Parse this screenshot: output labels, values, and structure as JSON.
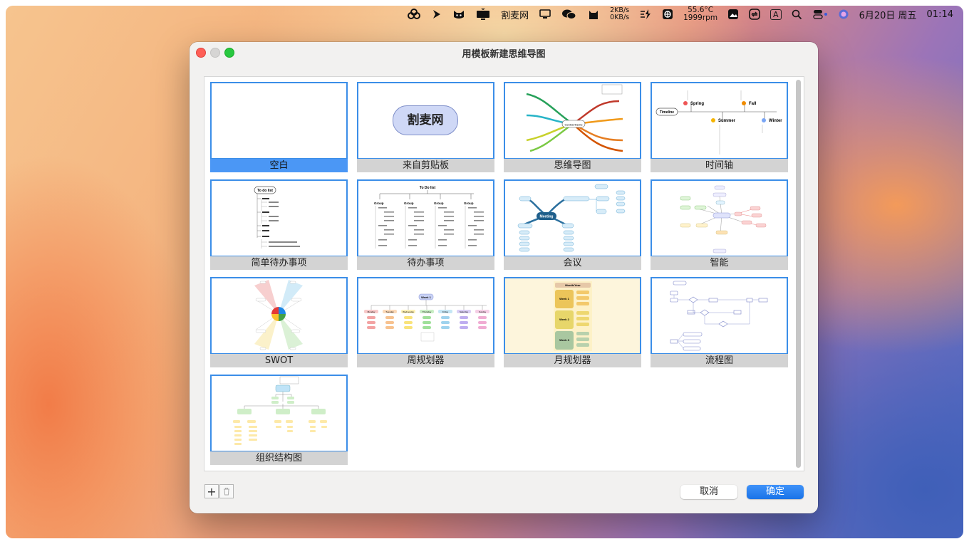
{
  "menubar": {
    "icons": [
      "cloud-sync-icon",
      "play-icon",
      "cat-face-icon",
      "monitor-shield-icon"
    ],
    "app_name": "割麦网",
    "net_up": "2KB/s",
    "net_down": "0KB/s",
    "temperature": "55.6°C",
    "fan_speed": "1999rpm",
    "input_source": "A",
    "date": "6月20日 周五",
    "time": "01:14"
  },
  "window": {
    "title": "用模板新建思维导图"
  },
  "templates": [
    {
      "label": "空白",
      "selected": true
    },
    {
      "label": "来自剪贴板",
      "preview_text": "割麦网"
    },
    {
      "label": "思维导图",
      "preview_text": "Central theme"
    },
    {
      "label": "时间轴",
      "preview": {
        "root": "Timeline",
        "nodes": [
          "Spring",
          "Summer",
          "Fall",
          "Winter"
        ]
      }
    },
    {
      "label": "简单待办事项",
      "preview_text": "To do list"
    },
    {
      "label": "待办事项",
      "preview": {
        "title": "To Do list",
        "groups": [
          "Group",
          "Group",
          "Group",
          "Group"
        ]
      }
    },
    {
      "label": "会议",
      "preview_text": "Meeting"
    },
    {
      "label": "智能"
    },
    {
      "label": "SWOT"
    },
    {
      "label": "周规划器",
      "preview": {
        "title": "Week 1",
        "days": [
          "Monday",
          "Tuesday",
          "Wednesday",
          "Thursday",
          "Friday",
          "Saturday",
          "Sunday"
        ]
      }
    },
    {
      "label": "月规划器",
      "preview": {
        "title": "Month/Year",
        "weeks": [
          "Week 1",
          "Week 2",
          "Week 3"
        ]
      }
    },
    {
      "label": "流程图"
    },
    {
      "label": "组织结构图"
    }
  ],
  "footer": {
    "add_label": "+",
    "cancel_label": "取消",
    "ok_label": "确定"
  },
  "colors": {
    "accent": "#1a73e8",
    "selection": "#4b97f5",
    "thumb_border": "#3b8ee8"
  }
}
